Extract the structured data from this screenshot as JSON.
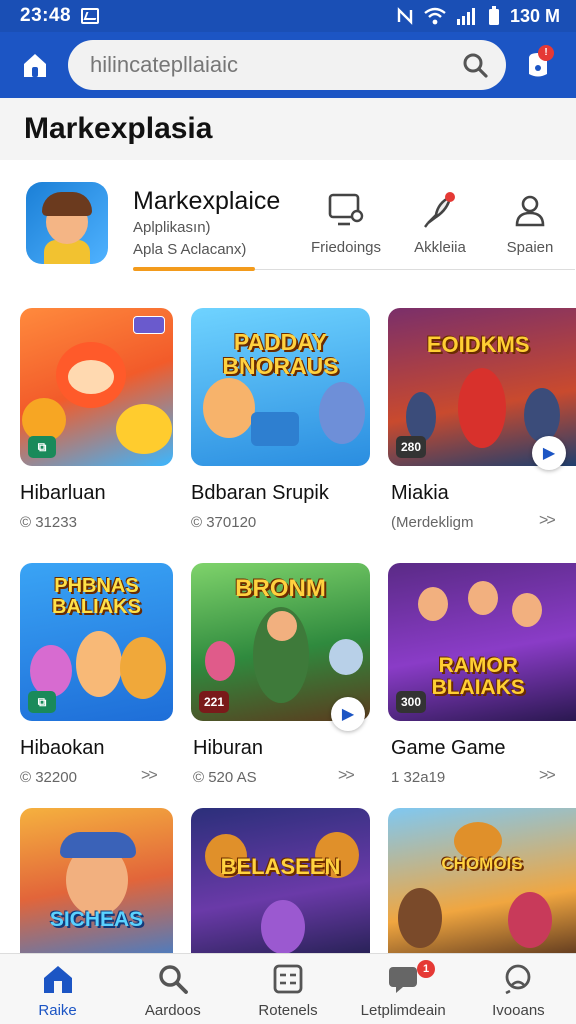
{
  "status_bar": {
    "time": "23:48",
    "battery": "130 M",
    "icons": [
      "image-icon",
      "nfc-icon",
      "wifi-icon",
      "signal-icon",
      "battery-icon"
    ]
  },
  "top_bar": {
    "search_value": "hilincatepllaiaic",
    "icons": [
      "home-icon",
      "search-icon",
      "notification-icon"
    ]
  },
  "page": {
    "title": "Markexplasia"
  },
  "profile": {
    "name": "Markexplaice",
    "subtitle_1": "Aplplikasın)",
    "subtitle_2": "Apla S Aclacanx)"
  },
  "quick_actions": [
    {
      "icon": "device-icon",
      "label": "Friedoings"
    },
    {
      "icon": "rocket-icon",
      "label": "Akkleiia"
    },
    {
      "icon": "person-icon",
      "label": "Spaien"
    }
  ],
  "cards": [
    {
      "title": "Hibarluan",
      "meta": "© 31233",
      "badge": "",
      "banner": "",
      "arrow": ""
    },
    {
      "title": "Bdbaran Srupik",
      "meta": "© 370120",
      "badge": "",
      "banner": "PADDAY BNORAUS",
      "arrow": ""
    },
    {
      "title": "Miakia",
      "meta": "(Merdekligm",
      "badge": "280",
      "banner": "EOIDKMS",
      "arrow": ">>"
    },
    {
      "title": "Hibaokan",
      "meta": "© 32200",
      "badge": "",
      "banner": "PHBNAS BALIAKS",
      "arrow": ">>"
    },
    {
      "title": "Hiburan",
      "meta": "© 520 AS",
      "badge": "221",
      "banner": "BRONM",
      "arrow": ">>"
    },
    {
      "title": "Game Game",
      "meta": "1 32a19",
      "badge": "300",
      "banner": "RAMOR BLAIAKS",
      "arrow": ">>"
    },
    {
      "title": "",
      "meta": "",
      "badge": "",
      "banner": "SICHEAS",
      "arrow": ""
    },
    {
      "title": "",
      "meta": "",
      "badge": "",
      "banner": "BELASEEN",
      "arrow": ""
    },
    {
      "title": "",
      "meta": "",
      "badge": "",
      "banner": "CHOMOIS",
      "arrow": ""
    }
  ],
  "bottom_nav": [
    {
      "icon": "home-icon",
      "label": "Raike",
      "active": true,
      "badge": ""
    },
    {
      "icon": "search-icon",
      "label": "Aardoos",
      "active": false,
      "badge": ""
    },
    {
      "icon": "grid-icon",
      "label": "Rotenels",
      "active": false,
      "badge": ""
    },
    {
      "icon": "chat-icon",
      "label": "Letplimdeain",
      "active": false,
      "badge": "1"
    },
    {
      "icon": "profile-icon",
      "label": "Ivooans",
      "active": false,
      "badge": ""
    }
  ],
  "colors": {
    "brand_blue": "#1c55c4",
    "accent_orange": "#f39b1c",
    "badge_red": "#e53935"
  }
}
